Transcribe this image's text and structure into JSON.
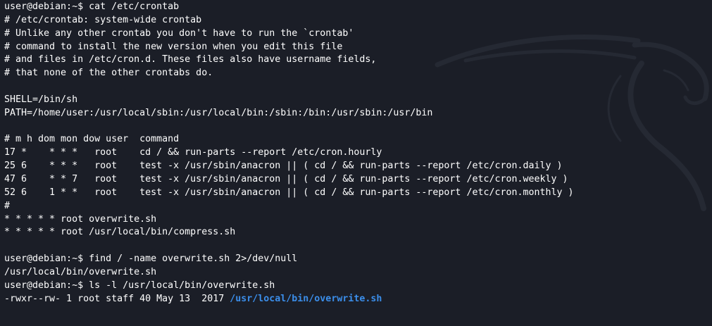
{
  "terminal": {
    "lines": [
      [
        {
          "t": "user@debian:~$ cat /etc/crontab"
        }
      ],
      [
        {
          "t": "# /etc/crontab: system-wide crontab"
        }
      ],
      [
        {
          "t": "# Unlike any other crontab you don't have to run the `crontab'"
        }
      ],
      [
        {
          "t": "# command to install the new version when you edit this file"
        }
      ],
      [
        {
          "t": "# and files in /etc/cron.d. These files also have username fields,"
        }
      ],
      [
        {
          "t": "# that none of the other crontabs do."
        }
      ],
      [
        {
          "t": ""
        }
      ],
      [
        {
          "t": "SHELL=/bin/sh"
        }
      ],
      [
        {
          "t": "PATH=/home/user:/usr/local/sbin:/usr/local/bin:/sbin:/bin:/usr/sbin:/usr/bin"
        }
      ],
      [
        {
          "t": ""
        }
      ],
      [
        {
          "t": "# m h dom mon dow user  command"
        }
      ],
      [
        {
          "t": "17 *    * * *   root    cd / && run-parts --report /etc/cron.hourly"
        }
      ],
      [
        {
          "t": "25 6    * * *   root    test -x /usr/sbin/anacron || ( cd / && run-parts --report /etc/cron.daily )"
        }
      ],
      [
        {
          "t": "47 6    * * 7   root    test -x /usr/sbin/anacron || ( cd / && run-parts --report /etc/cron.weekly )"
        }
      ],
      [
        {
          "t": "52 6    1 * *   root    test -x /usr/sbin/anacron || ( cd / && run-parts --report /etc/cron.monthly )"
        }
      ],
      [
        {
          "t": "#"
        }
      ],
      [
        {
          "t": "* * * * * root overwrite.sh"
        }
      ],
      [
        {
          "t": "* * * * * root /usr/local/bin/compress.sh"
        }
      ],
      [
        {
          "t": ""
        }
      ],
      [
        {
          "t": "user@debian:~$ find / -name overwrite.sh 2>/dev/null"
        }
      ],
      [
        {
          "t": "/usr/local/bin/overwrite.sh"
        }
      ],
      [
        {
          "t": "user@debian:~$ ls -l /usr/local/bin/overwrite.sh"
        }
      ],
      [
        {
          "t": "-rwxr--rw- 1 root staff 40 May 13  2017 "
        },
        {
          "t": "/usr/local/bin/overwrite.sh",
          "c": "exec-path"
        }
      ]
    ]
  },
  "colors": {
    "background": "#1b1e27",
    "foreground": "#ffffff",
    "executable": "#3b8eea",
    "logo": "#252933"
  },
  "icons": {
    "background_logo": "kali-dragon-icon"
  }
}
